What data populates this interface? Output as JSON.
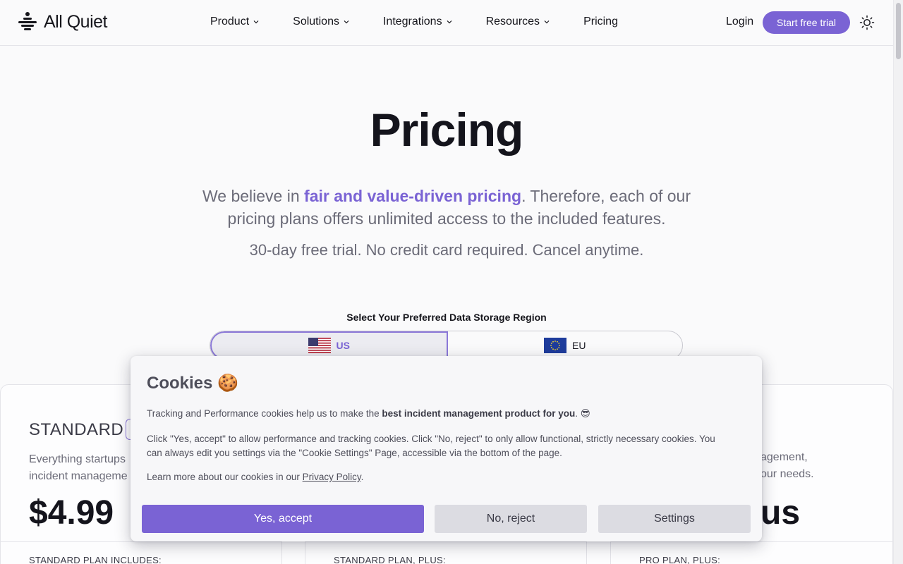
{
  "brand": {
    "name": "All Quiet",
    "accent": "#7a63d4"
  },
  "header": {
    "nav": [
      {
        "label": "Product",
        "dropdown": true
      },
      {
        "label": "Solutions",
        "dropdown": true
      },
      {
        "label": "Integrations",
        "dropdown": true
      },
      {
        "label": "Resources",
        "dropdown": true
      },
      {
        "label": "Pricing",
        "dropdown": false
      }
    ],
    "login": "Login",
    "trial_button": "Start free trial",
    "theme_icon": "sun-icon"
  },
  "hero": {
    "title": "Pricing",
    "lead_prefix": "We believe in ",
    "lead_highlight": "fair and value-driven pricing",
    "lead_suffix": ". Therefore, each of our pricing plans offers unlimited access to the included features.",
    "subtitle": "30-day free trial. No credit card required. Cancel anytime."
  },
  "region": {
    "label": "Select Your Preferred Data Storage Region",
    "options": [
      {
        "label": "US",
        "flag": "us-flag-icon",
        "selected": true
      },
      {
        "label": "EU",
        "flag": "eu-flag-icon",
        "selected": false
      }
    ]
  },
  "plans": {
    "standard": {
      "name": "STANDARD",
      "desc_line1": "Everything startups",
      "desc_line2": "incident manageme",
      "price": "$4.99",
      "includes_label": "STANDARD PLAN INCLUDES:"
    },
    "plus_label": "STANDARD PLAN, PLUS:",
    "pro": {
      "desc_line1": "agement,",
      "desc_line2": "our needs.",
      "price_fragment": "us",
      "includes_label": "PRO PLAN, PLUS:"
    }
  },
  "cookie_modal": {
    "title": "Cookies 🍪",
    "p1_prefix": "Tracking and Performance cookies help us to make the ",
    "p1_bold": "best incident management product for you",
    "p1_suffix": ". 😎",
    "p2": "Click \"Yes, accept\" to allow performance and tracking cookies. Click \"No, reject\" to only allow functional, strictly necessary cookies. You can always edit you settings via the \"Cookie Settings\" Page, accessible via the bottom of the page.",
    "p3_prefix": "Learn more about our cookies in our ",
    "p3_link": "Privacy Policy",
    "p3_suffix": ".",
    "accept": "Yes, accept",
    "reject": "No, reject",
    "settings": "Settings"
  }
}
